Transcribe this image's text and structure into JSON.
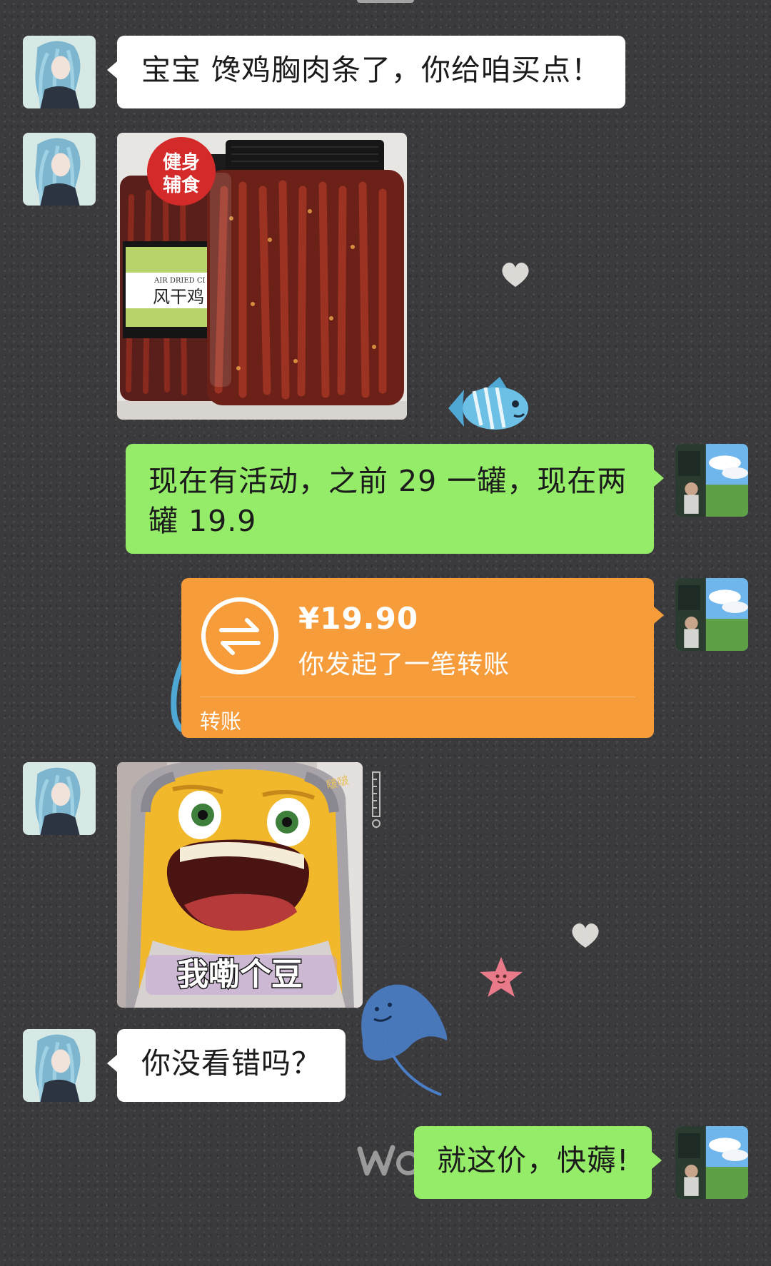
{
  "chat": {
    "messages": [
      {
        "sender": "other",
        "type": "text",
        "text": "宝宝 馋鸡胸肉条了，你给咱买点！"
      },
      {
        "sender": "other",
        "type": "image",
        "image": {
          "badge_line1": "健身",
          "badge_line2": "辅食",
          "label_en": "AIR DRIED CI",
          "label_cn": "风干鸡"
        }
      },
      {
        "sender": "me",
        "type": "text",
        "line1": "现在有活动，之前 29 一罐，现在两",
        "line2": "罐 19.9"
      },
      {
        "sender": "me",
        "type": "transfer",
        "amount": "¥19.90",
        "description": "你发起了一笔转账",
        "label": "转账"
      },
      {
        "sender": "other",
        "type": "sticker",
        "caption": "我嘞个豆",
        "watermark": "啵啵"
      },
      {
        "sender": "other",
        "type": "text",
        "text": "你没看错吗？"
      },
      {
        "sender": "me",
        "type": "text",
        "text": "就这价，快薅!"
      }
    ]
  },
  "colors": {
    "background": "#3b3b3d",
    "incoming_bubble": "#ffffff",
    "outgoing_bubble": "#95ec69",
    "transfer_bubble": "#f79c3a"
  }
}
